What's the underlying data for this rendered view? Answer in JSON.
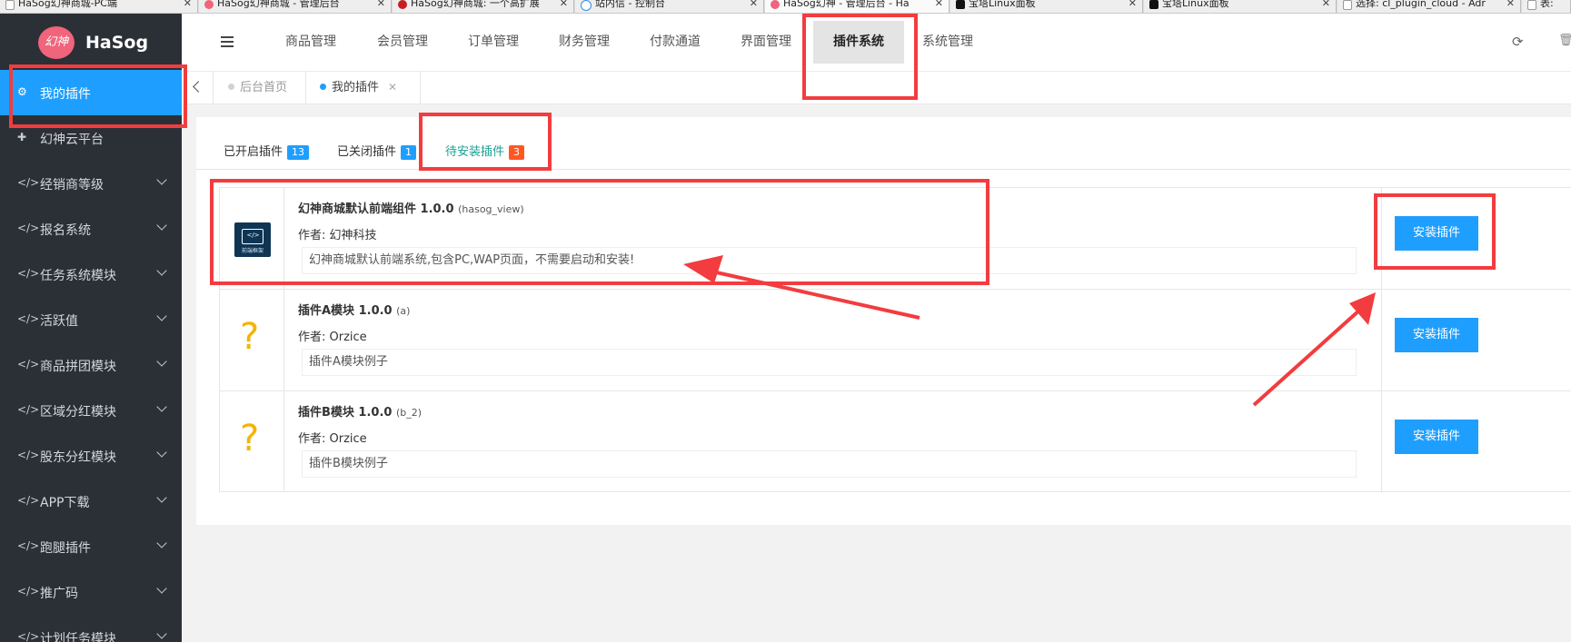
{
  "browser": {
    "tabs": [
      {
        "title": "HaSog幻神商城-PC端"
      },
      {
        "title": "HaSog幻神商城 - 管理后台"
      },
      {
        "title": "HaSog幻神商城: 一个高扩展"
      },
      {
        "title": "站内信 - 控制台"
      },
      {
        "title": "HaSog幻神 - 管理后台 - Ha"
      },
      {
        "title": "宝塔Linux面板"
      },
      {
        "title": "宝塔Linux面板"
      },
      {
        "title": "选择: cl_plugin_cloud - Adr"
      },
      {
        "title": "表:"
      }
    ]
  },
  "logo": {
    "badge_text": "幻神",
    "name": "HaSog",
    "badge_color": "#f0647c"
  },
  "sidebar": {
    "items": [
      {
        "label": "我的插件",
        "icon": "gears-icon",
        "active": true
      },
      {
        "label": "幻神云平台",
        "icon": "puzzle-icon"
      },
      {
        "label": "经销商等级",
        "icon": "code-icon"
      },
      {
        "label": "报名系统",
        "icon": "code-icon"
      },
      {
        "label": "任务系统模块",
        "icon": "code-icon"
      },
      {
        "label": "活跃值",
        "icon": "code-icon"
      },
      {
        "label": "商品拼团模块",
        "icon": "code-icon"
      },
      {
        "label": "区域分红模块",
        "icon": "code-icon"
      },
      {
        "label": "股东分红模块",
        "icon": "code-icon"
      },
      {
        "label": "APP下载",
        "icon": "code-icon"
      },
      {
        "label": "跑腿插件",
        "icon": "code-icon"
      },
      {
        "label": "推广码",
        "icon": "code-icon"
      },
      {
        "label": "计划任务模块",
        "icon": "code-icon"
      }
    ]
  },
  "topnav": {
    "items": [
      {
        "label": "商品管理"
      },
      {
        "label": "会员管理"
      },
      {
        "label": "订单管理"
      },
      {
        "label": "财务管理"
      },
      {
        "label": "付款通道"
      },
      {
        "label": "界面管理"
      },
      {
        "label": "插件系统",
        "active": true
      },
      {
        "label": "系统管理"
      }
    ],
    "refresh_icon": "refresh-icon",
    "trash_icon": "trash-icon"
  },
  "pagetabs": {
    "items": [
      {
        "label": "后台首页"
      },
      {
        "label": "我的插件",
        "current": true
      }
    ]
  },
  "subtabs": [
    {
      "label": "已开启插件",
      "count": "13"
    },
    {
      "label": "已关闭插件",
      "count": "1"
    },
    {
      "label": "待安装插件",
      "count": "3",
      "current": true
    }
  ],
  "plugins": [
    {
      "name": "幻神商城默认前端组件 1.0.0",
      "id": "(hasog_view)",
      "author": "作者: 幻神科技",
      "description": "幻神商城默认前端系统,包含PC,WAP页面，不需要启动和安装!",
      "icon": "view-icon",
      "icon_caption": "前端框架",
      "install_label": "安装插件"
    },
    {
      "name": "插件A模块 1.0.0",
      "id": "(a)",
      "author": "作者: Orzice",
      "description": "插件A模块例子",
      "icon": "question-icon",
      "icon_char": "?",
      "install_label": "安装插件"
    },
    {
      "name": "插件B模块 1.0.0",
      "id": "(b_2)",
      "author": "作者: Orzice",
      "description": "插件B模块例子",
      "icon": "question-icon",
      "icon_char": "?",
      "install_label": "安装插件"
    }
  ],
  "colors": {
    "accent": "#1e9fff",
    "sidebar_bg": "#2b3036",
    "annotation_red": "#f23c3f",
    "current_subtab": "#1aa094",
    "badge_orange": "#ff5722",
    "question_mark": "#f4b400"
  }
}
